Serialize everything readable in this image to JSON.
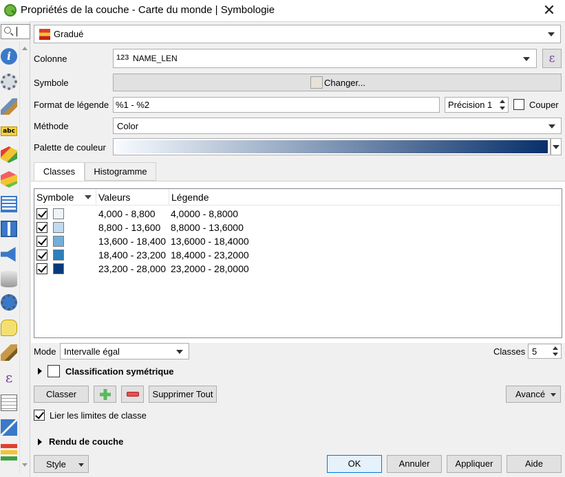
{
  "window": {
    "title": "Propriétés de la couche - Carte du monde | Symbologie",
    "close_glyph": "✕"
  },
  "sidebar": {
    "icons": [
      "search-icon",
      "information-icon",
      "source-settings-icon",
      "symbology-brush-icon",
      "labels-abc-icon",
      "3d-view-cube-icon",
      "diagrams-icon",
      "attributes-form-icon",
      "joins-icon",
      "auxiliary-storage-icon",
      "actions-icon",
      "display-tooltip-icon",
      "rendering-brush-icon",
      "variables-epsilon-icon",
      "metadata-icon",
      "dependencies-icon",
      "legend-icon"
    ],
    "abc_text": "abc",
    "epsilon_text": "ε"
  },
  "renderer": {
    "type": "Gradué"
  },
  "form": {
    "column_label": "Colonne",
    "column_type_badge": "123",
    "column_value": "NAME_LEN",
    "expression_glyph": "ε",
    "symbol_label": "Symbole",
    "symbol_change": "Changer...",
    "legend_format_label": "Format de légende",
    "legend_format_value": "%1 - %2",
    "precision_label": "Précision",
    "precision_value": "1",
    "trim_label": "Couper",
    "method_label": "Méthode",
    "method_value": "Color",
    "ramp_label": "Palette de couleur"
  },
  "tabs": [
    {
      "label": "Classes",
      "active": true
    },
    {
      "label": "Histogramme",
      "active": false
    }
  ],
  "table": {
    "headers": [
      "Symbole",
      "Valeurs",
      "Légende"
    ],
    "rows": [
      {
        "checked": true,
        "color": "#eef4fb",
        "values": "4,000 - 8,800",
        "legend": "4,0000 - 8,8000"
      },
      {
        "checked": true,
        "color": "#c3d9ee",
        "values": "8,800 - 13,600",
        "legend": "8,8000 - 13,6000"
      },
      {
        "checked": true,
        "color": "#73afd9",
        "values": "13,600 - 18,400",
        "legend": "13,6000 - 18,4000"
      },
      {
        "checked": true,
        "color": "#2e7ebc",
        "values": "18,400 - 23,200",
        "legend": "18,4000 - 23,2000"
      },
      {
        "checked": true,
        "color": "#083a7a",
        "values": "23,200 - 28,000",
        "legend": "23,2000 - 28,0000"
      }
    ]
  },
  "classification": {
    "mode_label": "Mode",
    "mode_value": "Intervalle égal",
    "classes_label": "Classes",
    "classes_value": "5",
    "symmetric_label": "Classification symétrique",
    "classify_button": "Classer",
    "delete_all_button": "Supprimer Tout",
    "advanced_button": "Avancé",
    "link_label": "Lier les limites de classe",
    "link_checked": true,
    "layer_rendering_label": "Rendu de couche"
  },
  "footer": {
    "style_button": "Style",
    "ok_button": "OK",
    "cancel_button": "Annuler",
    "apply_button": "Appliquer",
    "help_button": "Aide"
  },
  "colors": {
    "ramp_start": "#f7fbff",
    "ramp_end": "#08306b",
    "accent": "#0078d7"
  }
}
